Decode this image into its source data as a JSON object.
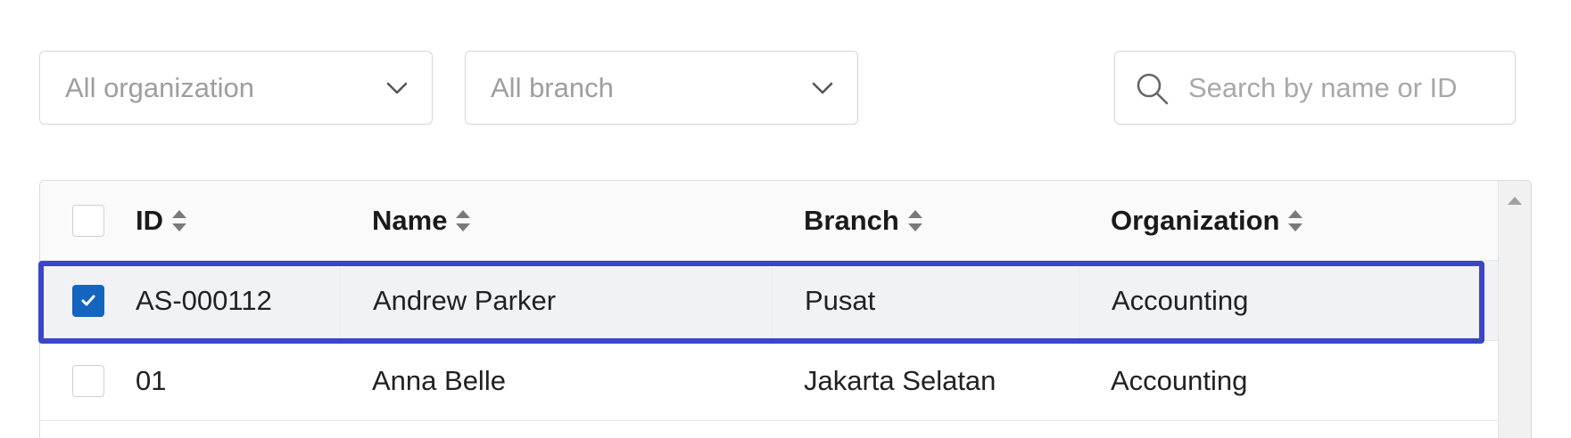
{
  "filters": {
    "organization_placeholder": "All organization",
    "branch_placeholder": "All branch",
    "search_placeholder": "Search by name or ID"
  },
  "table": {
    "columns": {
      "id": "ID",
      "name": "Name",
      "branch": "Branch",
      "organization": "Organization"
    },
    "rows": [
      {
        "selected": true,
        "id": "AS-000112",
        "name": "Andrew Parker",
        "branch": "Pusat",
        "organization": "Accounting"
      },
      {
        "selected": false,
        "id": "01",
        "name": "Anna Belle",
        "branch": "Jakarta Selatan",
        "organization": "Accounting"
      }
    ]
  },
  "colors": {
    "highlight": "#3a45c8",
    "checkbox_checked": "#1565c0",
    "selected_row_bg": "#f1f2f6"
  },
  "icons": [
    "chevron-down-icon",
    "search-icon",
    "sort-icon",
    "check-icon",
    "scroll-up-arrow-icon"
  ]
}
